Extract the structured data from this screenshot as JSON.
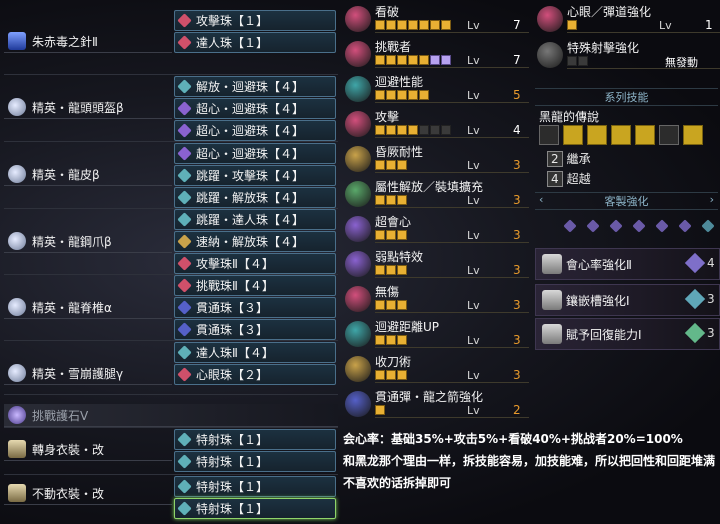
{
  "equipment": {
    "rows": [
      {
        "name": "朱赤毒之針Ⅱ",
        "icon": "weapon-icon",
        "slots": [
          "攻擊珠【１】",
          "達人珠【１】"
        ]
      },
      {
        "name": "精英・龍頭頭盔β",
        "icon": "helm-icon",
        "slots": [
          "解放・迴避珠【４】",
          "超心・迴避珠【４】",
          "超心・迴避珠【４】"
        ]
      },
      {
        "name": "精英・龍皮β",
        "icon": "chest-icon",
        "slots": [
          "超心・迴避珠【４】",
          "跳躍・攻擊珠【４】",
          "跳躍・解放珠【４】"
        ]
      },
      {
        "name": "精英・龍鋼爪β",
        "icon": "arm-icon",
        "slots": [
          "跳躍・達人珠【４】",
          "速納・解放珠【４】",
          "攻擊珠Ⅱ【４】"
        ]
      },
      {
        "name": "精英・龍脊椎α",
        "icon": "waist-icon",
        "slots": [
          "挑戰珠Ⅱ【４】",
          "貫通珠【３】",
          "貫通珠【３】"
        ]
      },
      {
        "name": "精英・雪崩護腿γ",
        "icon": "leg-icon",
        "slots": [
          "達人珠Ⅱ【４】",
          "心眼珠【２】"
        ]
      },
      {
        "name": "挑戰護石Ⅴ",
        "icon": "charm-icon",
        "slots": []
      },
      {
        "name": "轉身衣裝・改",
        "icon": "mantle-icon",
        "slots": [
          "特射珠【１】",
          "特射珠【１】"
        ]
      },
      {
        "name": "不動衣裝・改",
        "icon": "mantle-icon",
        "slots": [
          "特射珠【１】",
          "特射珠【１】"
        ]
      }
    ]
  },
  "skills": [
    {
      "name": "看破",
      "lv": "7",
      "on": 7,
      "ex": 0,
      "max": 7,
      "color": "#d24f7c",
      "lvcolor": "#ffffff"
    },
    {
      "name": "挑戰者",
      "lv": "7",
      "on": 5,
      "ex": 2,
      "max": 7,
      "color": "#d24f7c",
      "lvcolor": "#ffffff"
    },
    {
      "name": "迴避性能",
      "lv": "5",
      "on": 5,
      "ex": 0,
      "max": 5,
      "color": "#3fa6a8",
      "lvcolor": "#e89a2c"
    },
    {
      "name": "攻擊",
      "lv": "4",
      "on": 4,
      "ex": 0,
      "max": 7,
      "color": "#d24f7c",
      "lvcolor": "#ffffff"
    },
    {
      "name": "昏厥耐性",
      "lv": "3",
      "on": 3,
      "ex": 0,
      "max": 3,
      "color": "#c9a24a",
      "lvcolor": "#e89a2c"
    },
    {
      "name": "屬性解放／裝填擴充",
      "lv": "3",
      "on": 3,
      "ex": 0,
      "max": 3,
      "color": "#5aa86a",
      "lvcolor": "#e89a2c"
    },
    {
      "name": "超會心",
      "lv": "3",
      "on": 3,
      "ex": 0,
      "max": 3,
      "color": "#8a62d0",
      "lvcolor": "#e89a2c"
    },
    {
      "name": "弱點特效",
      "lv": "3",
      "on": 3,
      "ex": 0,
      "max": 3,
      "color": "#8a62d0",
      "lvcolor": "#e89a2c"
    },
    {
      "name": "無傷",
      "lv": "3",
      "on": 3,
      "ex": 0,
      "max": 3,
      "color": "#d24f7c",
      "lvcolor": "#e89a2c"
    },
    {
      "name": "迴避距離UP",
      "lv": "3",
      "on": 3,
      "ex": 0,
      "max": 3,
      "color": "#3fa6a8",
      "lvcolor": "#e89a2c"
    },
    {
      "name": "收刀術",
      "lv": "3",
      "on": 3,
      "ex": 0,
      "max": 3,
      "color": "#c9a24a",
      "lvcolor": "#e89a2c"
    },
    {
      "name": "貫通彈・龍之箭強化",
      "lv": "2",
      "on": 1,
      "ex": 0,
      "max": 1,
      "color": "#5560c8",
      "lvcolor": "#e89a2c"
    }
  ],
  "right_skills": [
    {
      "name": "心眼／彈道強化",
      "lv": "1",
      "on": 1,
      "max": 1,
      "color": "#d24f7c"
    },
    {
      "name": "特殊射擊強化",
      "lv": "無發動",
      "on": 1,
      "max": 2,
      "color": "#777777"
    }
  ],
  "set_header": "系列技能",
  "set_skill": {
    "name": "黑龍的傳說",
    "tiers": [
      {
        "n": "2",
        "label": "繼承"
      },
      {
        "n": "4",
        "label": "超越"
      }
    ]
  },
  "custom_header": "客製強化",
  "custom": [
    {
      "label": "會心率強化Ⅱ",
      "num": "4",
      "gem": "#7e6fc9"
    },
    {
      "label": "鑲嵌槽強化Ⅰ",
      "num": "3",
      "gem": "#5fa7b8"
    },
    {
      "label": "賦予回復能力Ⅰ",
      "num": "3",
      "gem": "#63b88a"
    }
  ],
  "note": [
    "会心率：基础35%+攻击5%+看破40%+挑战者20%=100%",
    "和黑龙那个理由一样，拆技能容易，加技能难，所以把回性和回距堆满",
    "不喜欢的话拆掉即可"
  ]
}
